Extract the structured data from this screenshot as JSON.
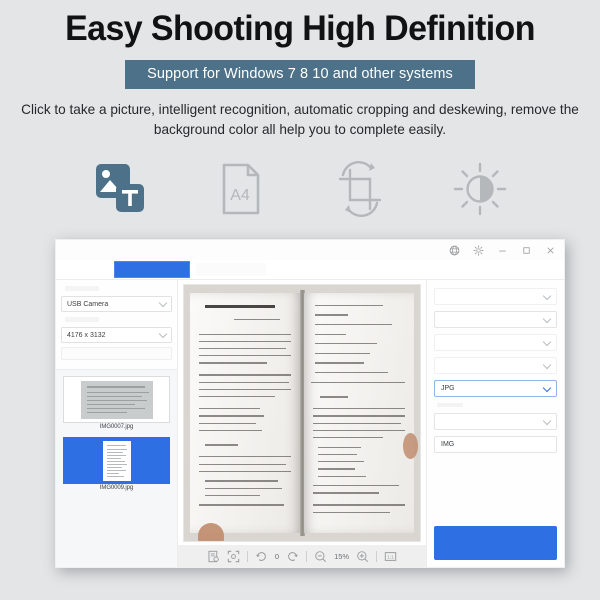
{
  "header": {
    "headline": "Easy Shooting High Definition",
    "banner": "Support for Windows 7 8 10 and other systems",
    "description": "Click to take a picture, intelligent recognition, automatic cropping and deskewing, remove the background color all help you to complete easily.",
    "banner_color": "#4d7189",
    "headline_color": "#111213"
  },
  "features": [
    {
      "icon": "image-text-icon",
      "label": "Image and text capture",
      "color": "#4d7189"
    },
    {
      "icon": "a4-document-icon",
      "label": "A4",
      "color": "#b4b8bb"
    },
    {
      "icon": "crop-rotate-icon",
      "label": "Auto crop and deskew",
      "color": "#b4b8bb"
    },
    {
      "icon": "brightness-icon",
      "label": "Brightness and contrast",
      "color": "#b4b8bb"
    }
  ],
  "app": {
    "titlebar": {
      "icons": [
        {
          "name": "globe-icon",
          "label": "Language"
        },
        {
          "name": "gear-icon",
          "label": "Settings"
        },
        {
          "name": "minimize-icon",
          "label": "Minimize"
        },
        {
          "name": "maximize-icon",
          "label": "Maximize"
        },
        {
          "name": "close-icon",
          "label": "Close"
        }
      ]
    },
    "tabs": [
      {
        "label": "",
        "active": true
      },
      {
        "label": "",
        "active": false
      }
    ],
    "left_panel": {
      "camera_label": "",
      "camera_value": "USB Camera",
      "resolution_label": "",
      "resolution_value": "4176 x 3132",
      "capture_button": "",
      "thumbnails": [
        {
          "name": "IMG0007.jpg",
          "selected": false
        },
        {
          "name": "IMG0009.jpg",
          "selected": true
        }
      ]
    },
    "toolbar": {
      "buttons": [
        {
          "name": "scan-document-icon",
          "label": "Scan document"
        },
        {
          "name": "fit-frame-icon",
          "label": "Fit to frame"
        },
        {
          "name": "rotate-left-icon",
          "label": "Rotate left"
        },
        {
          "name": "rotate-right-icon",
          "label": "Rotate right"
        },
        {
          "name": "zoom-out-icon",
          "label": "Zoom out"
        },
        {
          "name": "zoom-in-icon",
          "label": "Zoom in"
        },
        {
          "name": "actual-size-icon",
          "label": "1:1"
        }
      ],
      "rotation_value": "0",
      "zoom_value": "15%",
      "actual_size_label": "1:1"
    },
    "right_panel": {
      "fields": [
        {
          "name": "option-1",
          "value": "",
          "active": false
        },
        {
          "name": "option-2",
          "value": "",
          "active": false
        },
        {
          "name": "option-3",
          "value": "",
          "active": false
        },
        {
          "name": "option-4",
          "value": "",
          "active": false
        },
        {
          "name": "format-select",
          "value": "JPG",
          "active": true
        },
        {
          "name": "option-6",
          "value": "",
          "active": false
        }
      ],
      "filename_value": "IMG",
      "save_button": ""
    }
  },
  "colors": {
    "page_background": "#e3e5e6",
    "accent_blue": "#2f6fe4",
    "steel_blue": "#4d7189",
    "toolbar_gray": "#efefef"
  }
}
